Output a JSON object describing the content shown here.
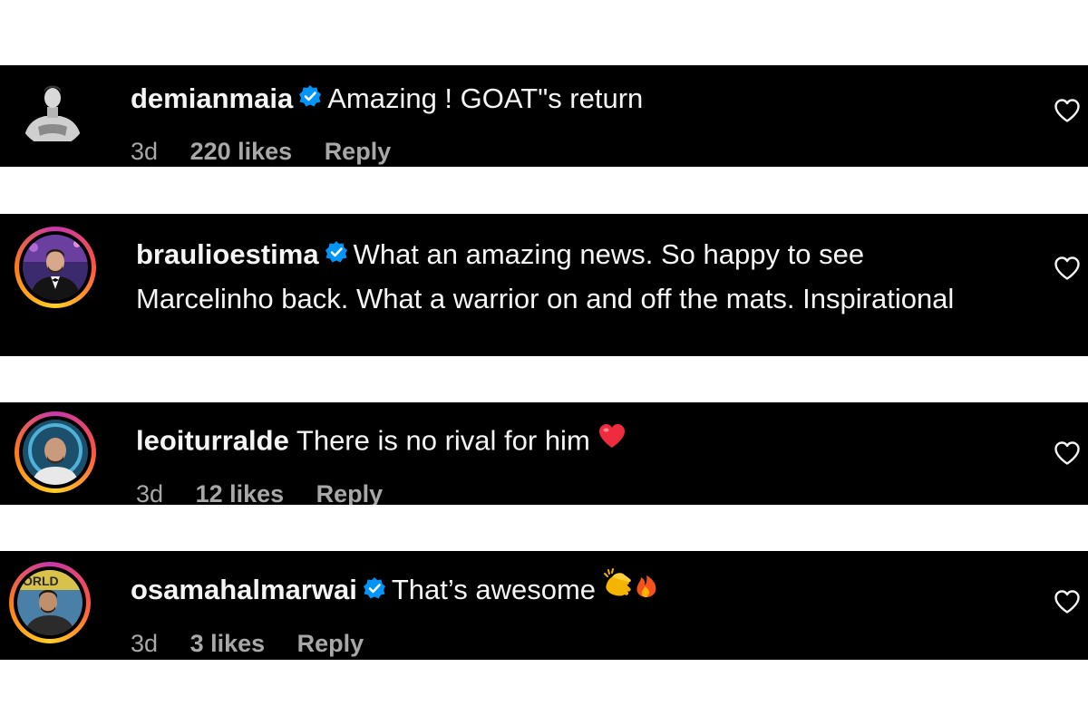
{
  "comments": [
    {
      "username": "demianmaia",
      "verified": true,
      "text": "Amazing ! GOAT\"s return",
      "time": "3d",
      "likes": "220 likes",
      "reply": "Reply",
      "avatar": "bodybuilder-avatar"
    },
    {
      "username": "braulioestima",
      "verified": true,
      "text": "What an amazing news. So happy to see Marcelinho back. What a warrior on and off the mats. Inspirational",
      "avatar": "tuxedo-man-avatar"
    },
    {
      "username": "leoiturralde",
      "verified": false,
      "text": "There is no rival for him",
      "emoji": "red-heart-emoji",
      "time": "3d",
      "likes": "12 likes",
      "reply": "Reply",
      "avatar": "bald-man-avatar"
    },
    {
      "username": "osamahalmarwai",
      "verified": true,
      "text": "That’s awesome",
      "emoji": "clapping-hands-fire-emoji",
      "time": "3d",
      "likes": "3 likes",
      "reply": "Reply",
      "avatar": "man-outdoors-avatar",
      "avatar_sign_text": "ORLD"
    }
  ],
  "icons": {
    "like": "heart-outline-icon",
    "verified": "verified-badge-icon"
  },
  "colors": {
    "strip_background": "#000000",
    "text": "#f5f5f5",
    "meta_text": "#a8a8a8",
    "verified_badge": "#0095f6",
    "page_background": "#ffffff"
  }
}
